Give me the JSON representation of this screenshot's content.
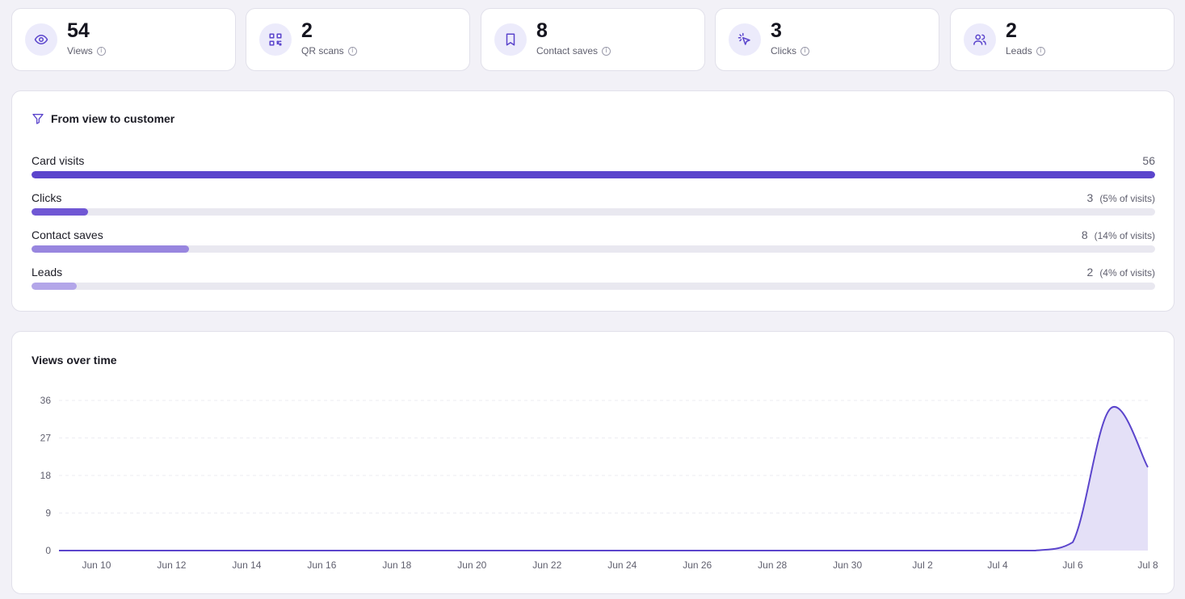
{
  "stats": [
    {
      "value": "54",
      "label": "Views",
      "icon": "eye-icon"
    },
    {
      "value": "2",
      "label": "QR scans",
      "icon": "qr-code-icon"
    },
    {
      "value": "8",
      "label": "Contact saves",
      "icon": "bookmark-icon"
    },
    {
      "value": "3",
      "label": "Clicks",
      "icon": "pointer-click-icon"
    },
    {
      "value": "2",
      "label": "Leads",
      "icon": "users-icon"
    }
  ],
  "funnel": {
    "title": "From view to customer",
    "icon": "filter-icon",
    "rows": [
      {
        "label": "Card visits",
        "value": "56",
        "pct": "",
        "fraction": 1.0,
        "color": "#5b45cc"
      },
      {
        "label": "Clicks",
        "value": "3",
        "pct": "(5% of visits)",
        "fraction": 0.05,
        "color": "#7057d4"
      },
      {
        "label": "Contact saves",
        "value": "8",
        "pct": "(14% of visits)",
        "fraction": 0.14,
        "color": "#9886df"
      },
      {
        "label": "Leads",
        "value": "2",
        "pct": "(4% of visits)",
        "fraction": 0.04,
        "color": "#b3a6e9"
      }
    ]
  },
  "colors": {
    "accent": "#5b45cc",
    "area_fill": "#e4e0f7"
  },
  "chart_data": {
    "type": "area",
    "title": "Views over time",
    "xlabel": "",
    "ylabel": "",
    "ylim": [
      0,
      36
    ],
    "y_ticks": [
      "0",
      "9",
      "18",
      "27",
      "36"
    ],
    "x_ticks": [
      "Jun 10",
      "Jun 12",
      "Jun 14",
      "Jun 16",
      "Jun 18",
      "Jun 20",
      "Jun 22",
      "Jun 24",
      "Jun 26",
      "Jun 28",
      "Jun 30",
      "Jul 2",
      "Jul 4",
      "Jul 6",
      "Jul 8"
    ],
    "grid": true,
    "series": [
      {
        "x": [
          "Jun 9",
          "Jun 10",
          "Jun 11",
          "Jun 12",
          "Jun 13",
          "Jun 14",
          "Jun 15",
          "Jun 16",
          "Jun 17",
          "Jun 18",
          "Jun 19",
          "Jun 20",
          "Jun 21",
          "Jun 22",
          "Jun 23",
          "Jun 24",
          "Jun 25",
          "Jun 26",
          "Jun 27",
          "Jun 28",
          "Jun 29",
          "Jun 30",
          "Jul 1",
          "Jul 2",
          "Jul 3",
          "Jul 4",
          "Jul 5",
          "Jul 6",
          "Jul 7",
          "Jul 8"
        ],
        "values": [
          0,
          0,
          0,
          0,
          0,
          0,
          0,
          0,
          0,
          0,
          0,
          0,
          0,
          0,
          0,
          0,
          0,
          0,
          0,
          0,
          0,
          0,
          0,
          0,
          0,
          0,
          0,
          2,
          34,
          20
        ]
      }
    ]
  }
}
